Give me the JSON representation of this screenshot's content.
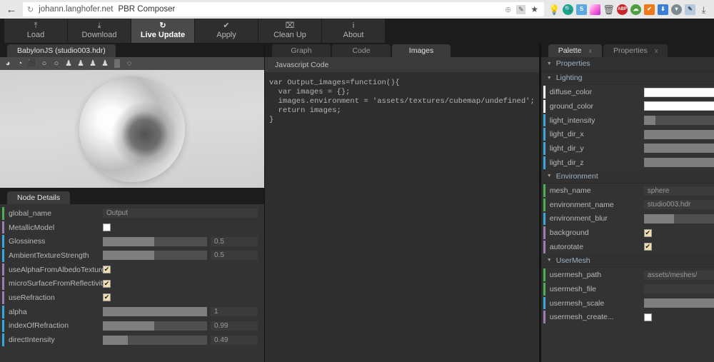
{
  "browser": {
    "back_icon": "arrow-left",
    "reload_icon": "reload",
    "url": "johann.langhofer.net",
    "page_title": "PBR Composer",
    "omni_icons": [
      {
        "name": "globe-icon",
        "glyph": "⊕"
      },
      {
        "name": "pencil-edit-icon",
        "glyph": "✐"
      },
      {
        "name": "bookmark-star-icon",
        "glyph": "★"
      }
    ],
    "extensions": [
      {
        "name": "lightbulb-extension-icon",
        "glyph": "♀",
        "color": "transparent",
        "plain": true
      },
      {
        "name": "search-magnifier-extension-icon",
        "glyph": "⚲",
        "color": "#17a589",
        "round": true
      },
      {
        "name": "evernote-extension-icon",
        "glyph": "S",
        "color": "#5aa9dd"
      },
      {
        "name": "color-gradient-extension-icon",
        "glyph": "",
        "color": "grad"
      },
      {
        "name": "trash-extension-icon",
        "glyph": "Ὕ1",
        "color": "transparent",
        "plain": true
      },
      {
        "name": "adblock-plus-extension-icon",
        "glyph": "ABP",
        "color": "#c9252b",
        "round": true
      },
      {
        "name": "cloud-extension-icon",
        "glyph": "☁",
        "color": "#4c9e3f",
        "round": true
      },
      {
        "name": "shield-check-extension-icon",
        "glyph": "✔",
        "color": "#f07818"
      },
      {
        "name": "download-arrow-extension-icon",
        "glyph": "⬇",
        "color": "#3a7fd5"
      },
      {
        "name": "balloon-extension-icon",
        "glyph": "▽",
        "color": "#7c8b92",
        "round": true
      },
      {
        "name": "notepad-extension-icon",
        "glyph": "✎",
        "color": "#b7c9dd"
      },
      {
        "name": "save-page-extension-icon",
        "glyph": "⤓",
        "color": "transparent",
        "plain": true
      }
    ]
  },
  "toolbar": {
    "buttons": [
      {
        "label": "Load",
        "icon": "upload-icon",
        "glyph": "⤒",
        "active": false
      },
      {
        "label": "Download",
        "icon": "download-icon",
        "glyph": "⤓",
        "active": false
      },
      {
        "label": "Live Update",
        "icon": "refresh-sync-icon",
        "glyph": "↻",
        "active": true
      },
      {
        "label": "Apply",
        "icon": "check-circle-icon",
        "glyph": "✔",
        "active": false
      },
      {
        "label": "Clean Up",
        "icon": "trash-icon",
        "glyph": "⌧",
        "active": false
      },
      {
        "label": "About",
        "icon": "info-icon",
        "glyph": "i",
        "active": false
      }
    ]
  },
  "viewport_panel": {
    "tab_label": "BabylonJS (studio003.hdr)",
    "tools": [
      {
        "name": "env-sphere-1-icon",
        "glyph": "◕"
      },
      {
        "name": "env-sphere-2-icon",
        "glyph": "◔"
      },
      {
        "name": "cube-mesh-icon",
        "glyph": "⬛"
      },
      {
        "name": "circle-outline-icon",
        "glyph": "○"
      },
      {
        "name": "circle-outline-2-icon",
        "glyph": "○"
      },
      {
        "name": "mesh-person-1-icon",
        "glyph": "♟"
      },
      {
        "name": "mesh-person-2-icon",
        "glyph": "♟"
      },
      {
        "name": "mesh-person-3-icon",
        "glyph": "♟"
      },
      {
        "name": "add-mesh-icon",
        "glyph": "♟"
      },
      {
        "name": "grid-toggle-icon",
        "glyph": "▒"
      },
      {
        "name": "loading-spinner-icon",
        "glyph": "◌"
      }
    ]
  },
  "node_details": {
    "tab_label": "Node Details",
    "rows": [
      {
        "label": "global_name",
        "type": "text",
        "value": "Output",
        "accent": "#4caf50"
      },
      {
        "label": "MetallicModel",
        "type": "check",
        "checked": false,
        "accent": "#a07cb0"
      },
      {
        "label": "Glossiness",
        "type": "slider",
        "value": "0.5",
        "fill": 49,
        "accent": "#3aa8e0"
      },
      {
        "label": "AmbientTextureStrength",
        "type": "slider",
        "value": "0.5",
        "fill": 49,
        "accent": "#3aa8e0"
      },
      {
        "label": "useAlphaFromAlbedoTexture",
        "type": "check",
        "checked": true,
        "accent": "#a07cb0"
      },
      {
        "label": "microSurfaceFromReflectivityAlpha",
        "type": "check",
        "checked": true,
        "accent": "#a07cb0"
      },
      {
        "label": "useRefraction",
        "type": "check",
        "checked": true,
        "accent": "#a07cb0"
      },
      {
        "label": "alpha",
        "type": "slider",
        "value": "1",
        "fill": 100,
        "accent": "#3aa8e0"
      },
      {
        "label": "indexOfRefraction",
        "type": "slider",
        "value": "0.99",
        "fill": 49,
        "accent": "#3aa8e0"
      },
      {
        "label": "directIntensity",
        "type": "slider",
        "value": "0.49",
        "fill": 24,
        "accent": "#3aa8e0"
      }
    ]
  },
  "code_panel": {
    "tabs": [
      {
        "label": "Graph",
        "active": false
      },
      {
        "label": "Code",
        "active": false
      },
      {
        "label": "Images",
        "active": true
      }
    ],
    "header": "Javascript Code",
    "code": "var Output_images=function(){\n  var images = {};\n  images.environment = 'assets/textures/cubemap/undefined';\n  return images;\n}"
  },
  "right_panel": {
    "tabs": [
      {
        "label": "Palette",
        "active": true,
        "close": "x"
      },
      {
        "label": "Properties",
        "active": false,
        "close": "x"
      }
    ],
    "groups": [
      {
        "label": "Properties",
        "rows": []
      },
      {
        "label": "Lighting",
        "rows": [
          {
            "label": "diffuse_color",
            "type": "color",
            "value": "#ffffff",
            "accent": "#ffffff"
          },
          {
            "label": "ground_color",
            "type": "color",
            "value": "#ffffff",
            "accent": "#ffffff"
          },
          {
            "label": "light_intensity",
            "type": "slider",
            "value": "1",
            "fill": 11,
            "accent": "#3aa8e0"
          },
          {
            "label": "light_dir_x",
            "type": "slider",
            "value": "1",
            "fill": 100,
            "accent": "#3aa8e0"
          },
          {
            "label": "light_dir_y",
            "type": "slider",
            "value": "1",
            "fill": 100,
            "accent": "#3aa8e0"
          },
          {
            "label": "light_dir_z",
            "type": "slider",
            "value": "1",
            "fill": 100,
            "accent": "#3aa8e0"
          }
        ]
      },
      {
        "label": "Environment",
        "rows": [
          {
            "label": "mesh_name",
            "type": "select",
            "value": "sphere",
            "accent": "#4caf50"
          },
          {
            "label": "environment_name",
            "type": "select",
            "value": "studio003.hdr",
            "accent": "#4caf50"
          },
          {
            "label": "environment_blur",
            "type": "slider",
            "value": "0.2",
            "fill": 29,
            "accent": "#3aa8e0"
          },
          {
            "label": "background",
            "type": "check",
            "checked": true,
            "accent": "#a07cb0"
          },
          {
            "label": "autorotate",
            "type": "check",
            "checked": true,
            "accent": "#a07cb0"
          }
        ]
      },
      {
        "label": "UserMesh",
        "rows": [
          {
            "label": "usermesh_path",
            "type": "text",
            "value": "assets/meshes/",
            "accent": "#4caf50"
          },
          {
            "label": "usermesh_file",
            "type": "text",
            "value": "",
            "accent": "#4caf50"
          },
          {
            "label": "usermesh_scale",
            "type": "slider",
            "value": "1",
            "fill": 100,
            "accent": "#3aa8e0"
          },
          {
            "label": "usermesh_create...",
            "type": "check",
            "checked": false,
            "accent": "#a07cb0"
          }
        ]
      }
    ]
  }
}
